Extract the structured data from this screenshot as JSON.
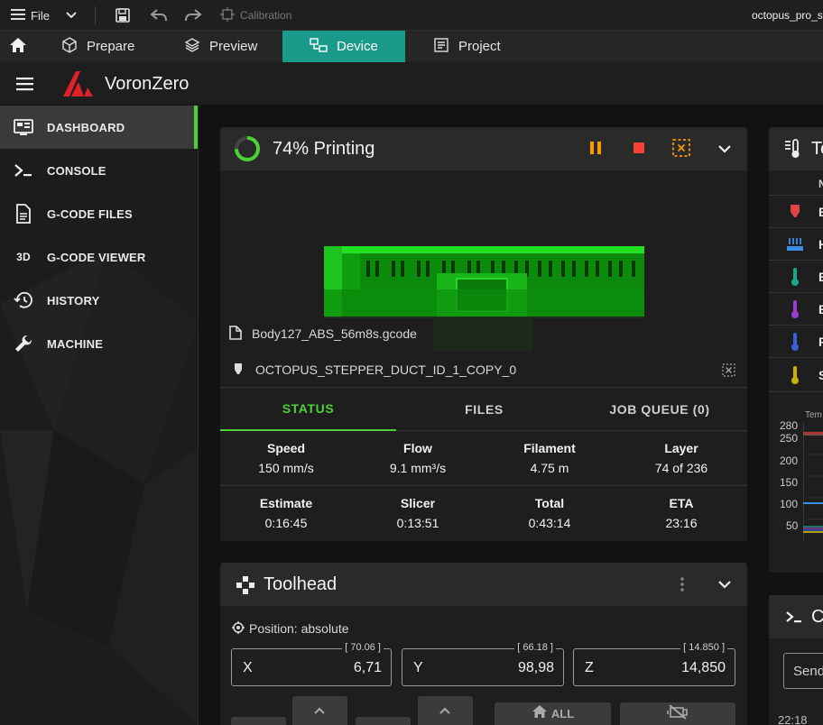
{
  "titlebar": {
    "file_label": "File",
    "calibration_label": "Calibration",
    "window_title": "octopus_pro_st"
  },
  "tabs": [
    {
      "label": "Prepare"
    },
    {
      "label": "Preview"
    },
    {
      "label": "Device"
    },
    {
      "label": "Project"
    }
  ],
  "app": {
    "brand": "VoronZero"
  },
  "sidebar": {
    "items": [
      {
        "label": "DASHBOARD"
      },
      {
        "label": "CONSOLE"
      },
      {
        "label": "G-CODE FILES"
      },
      {
        "label": "G-CODE VIEWER"
      },
      {
        "label": "HISTORY"
      },
      {
        "label": "MACHINE"
      }
    ]
  },
  "status_card": {
    "progress": 0.74,
    "title": "74% Printing",
    "filename": "Body127_ABS_56m8s.gcode",
    "object_name": "OCTOPUS_STEPPER_DUCT_ID_1_COPY_0",
    "subtabs": [
      "STATUS",
      "FILES",
      "JOB QUEUE (0)"
    ],
    "stats_row1": [
      {
        "label": "Speed",
        "value": "150 mm/s"
      },
      {
        "label": "Flow",
        "value": "9.1 mm³/s"
      },
      {
        "label": "Filament",
        "value": "4.75 m"
      },
      {
        "label": "Layer",
        "value": "74 of 236"
      }
    ],
    "stats_row2": [
      {
        "label": "Estimate",
        "value": "0:16:45"
      },
      {
        "label": "Slicer",
        "value": "0:13:51"
      },
      {
        "label": "Total",
        "value": "0:43:14"
      },
      {
        "label": "ETA",
        "value": "23:16"
      }
    ]
  },
  "toolhead_card": {
    "title": "Toolhead",
    "position_label": "Position: absolute",
    "axes": [
      {
        "axis": "X",
        "value": "6,71",
        "target": "[ 70.06 ]"
      },
      {
        "axis": "Y",
        "value": "98,98",
        "target": "[ 66.18 ]"
      },
      {
        "axis": "Z",
        "value": "14,850",
        "target": "[ 14.850 ]"
      }
    ],
    "home_all_label": "ALL"
  },
  "temps_card": {
    "title_partial": "Te",
    "col_header_partial": "N",
    "rows_partial": [
      "E",
      "H",
      "E",
      "E",
      "F",
      "S"
    ],
    "chart_label_partial": "Tem",
    "y_ticks": [
      "280",
      "250",
      "200",
      "150",
      "100",
      "50"
    ]
  },
  "console_card": {
    "title_partial": "C",
    "send_partial": "Send",
    "time_partial": "22:18"
  },
  "colors": {
    "accent_green": "#4cd137",
    "tab_active": "#1a9a8a",
    "pause_orange": "#ff9800",
    "stop_red": "#f44336",
    "brand_red": "#e0202a"
  }
}
